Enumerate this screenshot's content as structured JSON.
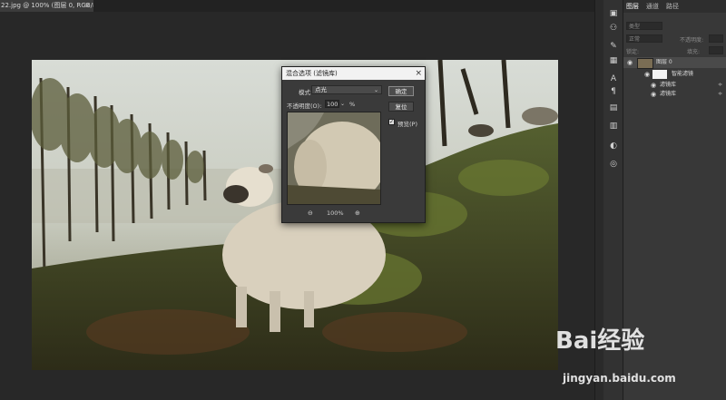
{
  "document": {
    "tab_title": "22.jpg @ 100% (图层 0, RGB/8) *",
    "close_glyph": "×"
  },
  "panel": {
    "tabs": [
      "图层",
      "通道",
      "路径"
    ],
    "search_placeholder": "类型",
    "blend_mode": "正常",
    "opacity_label": "不透明度:",
    "lock_label": "锁定:",
    "fill_label": "填充:",
    "layers": [
      {
        "name": "图层 0"
      },
      {
        "name": "智能滤镜"
      },
      {
        "name": "滤镜库"
      },
      {
        "name": "滤镜库"
      }
    ]
  },
  "dialog": {
    "title": "混合选项 (滤镜库)",
    "close_glyph": "×",
    "mode_label": "模式:",
    "mode_value": "点光",
    "opacity_label": "不透明度(O):",
    "opacity_value": "100",
    "percent": "%",
    "ok_label": "确定",
    "reset_label": "复位",
    "preview_label": "预览(P)",
    "preview_checked": true,
    "zoom_level": "100%"
  },
  "watermark": {
    "brand": "Bai经验",
    "url": "jingyan.baidu.com"
  },
  "icons": {
    "tools": [
      "history-icon",
      "properties-icon",
      "brush-icon",
      "swatches-icon",
      "character-icon",
      "paragraph-icon",
      "table-icon",
      "libraries-icon",
      "adjustments-icon",
      "styles-icon"
    ]
  }
}
